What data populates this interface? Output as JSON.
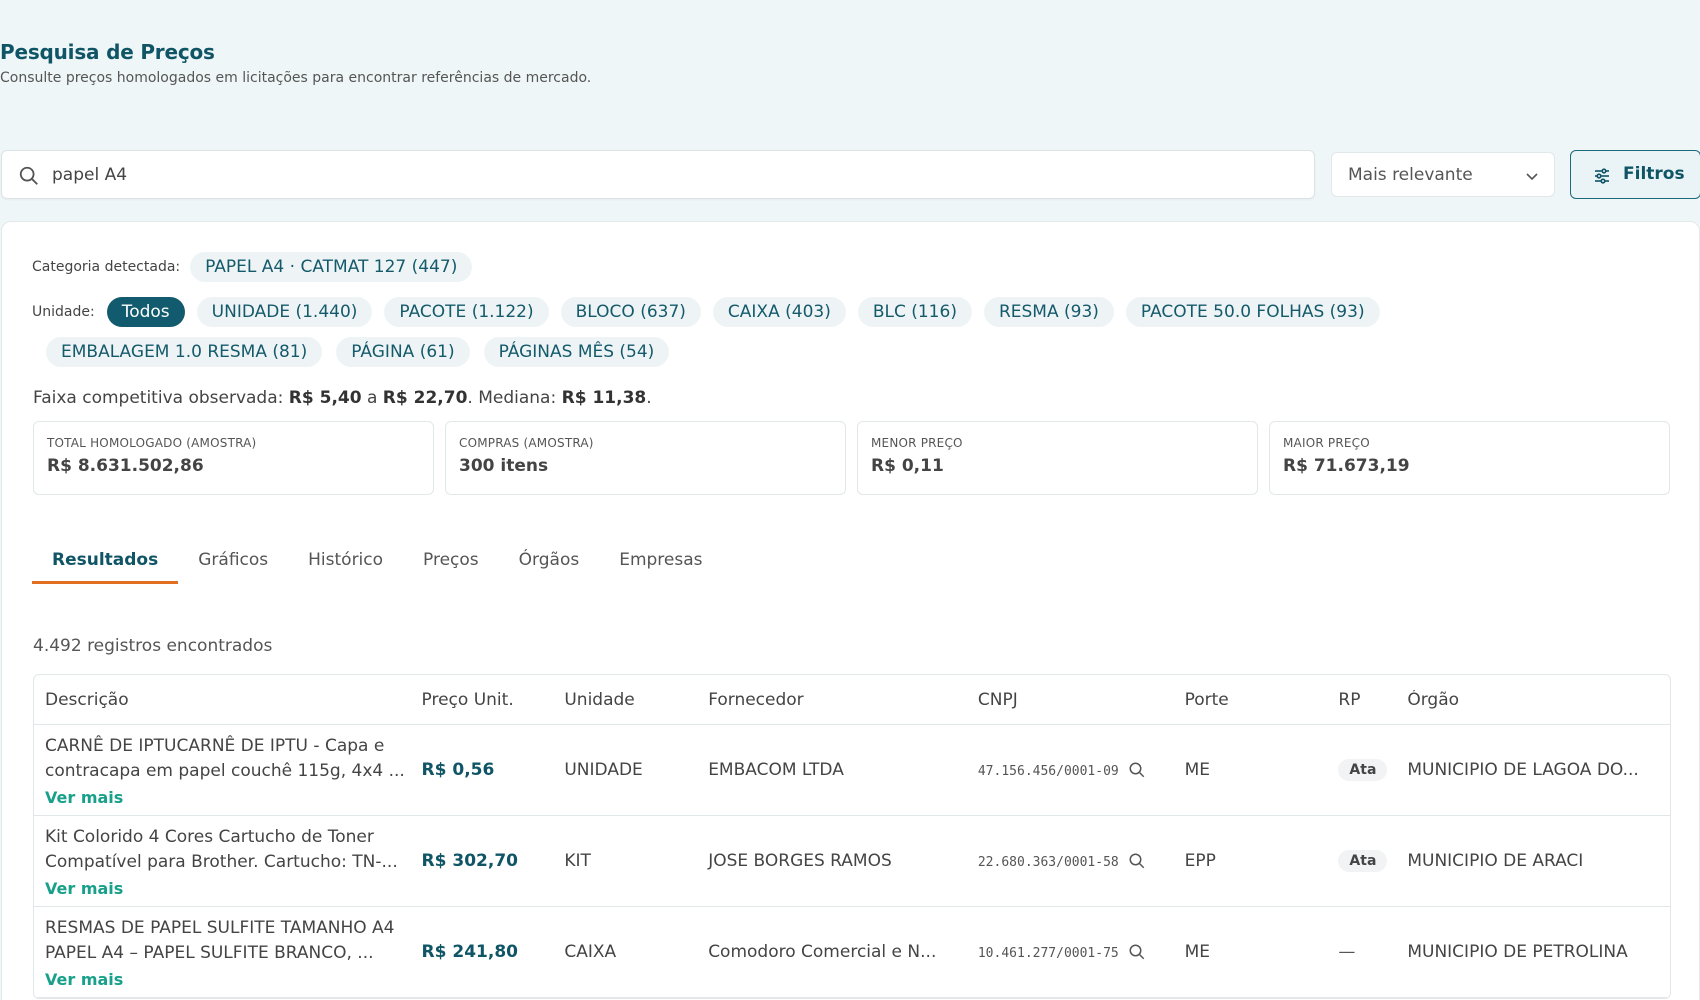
{
  "header": {
    "title": "Pesquisa de Preços",
    "subtitle": "Consulte preços homologados em licitações para encontrar referências de mercado."
  },
  "search": {
    "value": "papel A4",
    "sort_label": "Mais relevante",
    "filter_label": "Filtros"
  },
  "category": {
    "label": "Categoria detectada:",
    "chip": "PAPEL A4 · CATMAT 127 (447)"
  },
  "units": {
    "label": "Unidade:",
    "chips": [
      "Todos",
      "UNIDADE (1.440)",
      "PACOTE (1.122)",
      "BLOCO (637)",
      "CAIXA (403)",
      "BLC (116)",
      "RESMA (93)",
      "PACOTE 50.0 FOLHAS (93)",
      "EMBALAGEM 1.0 RESMA (81)",
      "PÁGINA (61)",
      "PÁGINAS MÊS (54)"
    ]
  },
  "range": {
    "prefix": "Faixa competitiva observada: ",
    "min": "R$ 5,40",
    "a": " a ",
    "max": "R$ 22,70",
    "median_prefix": ". Mediana: ",
    "median": "R$ 11,38",
    "suffix": "."
  },
  "stats": [
    {
      "label": "TOTAL HOMOLOGADO (AMOSTRA)",
      "value": "R$ 8.631.502,86"
    },
    {
      "label": "COMPRAS (AMOSTRA)",
      "value": "300 itens"
    },
    {
      "label": "MENOR PREÇO",
      "value": "R$ 0,11"
    },
    {
      "label": "MAIOR PREÇO",
      "value": "R$ 71.673,19"
    }
  ],
  "tabs": [
    "Resultados",
    "Gráficos",
    "Histórico",
    "Preços",
    "Órgãos",
    "Empresas"
  ],
  "results_count": "4.492 registros encontrados",
  "table": {
    "headers": [
      "Descrição",
      "Preço Unit.",
      "Unidade",
      "Fornecedor",
      "CNPJ",
      "Porte",
      "RP",
      "Órgão"
    ],
    "ver_mais": "Ver mais",
    "rows": [
      {
        "desc": "CARNÊ DE IPTUCARNÊ DE IPTU - Capa e contracapa em papel couchê 115g, 4x4 ...",
        "price": "R$ 0,56",
        "unit": "UNIDADE",
        "supplier": "EMBACOM LTDA",
        "cnpj": "47.156.456/0001-09",
        "porte": "ME",
        "rp": "Ata",
        "org": "MUNICIPIO DE LAGOA DO..."
      },
      {
        "desc": "Kit Colorido 4 Cores Cartucho de Toner Compatível para Brother. Cartucho: TN-...",
        "price": "R$ 302,70",
        "unit": "KIT",
        "supplier": "JOSE BORGES RAMOS",
        "cnpj": "22.680.363/0001-58",
        "porte": "EPP",
        "rp": "Ata",
        "org": "MUNICIPIO DE ARACI"
      },
      {
        "desc": "RESMAS DE PAPEL SULFITE TAMANHO A4 PAPEL A4 – PAPEL SULFITE BRANCO, ...",
        "price": "R$ 241,80",
        "unit": "CAIXA",
        "supplier": "Comodoro Comercial e N...",
        "cnpj": "10.461.277/0001-75",
        "porte": "ME",
        "rp": "—",
        "org": "MUNICIPIO DE PETROLINA"
      }
    ]
  }
}
